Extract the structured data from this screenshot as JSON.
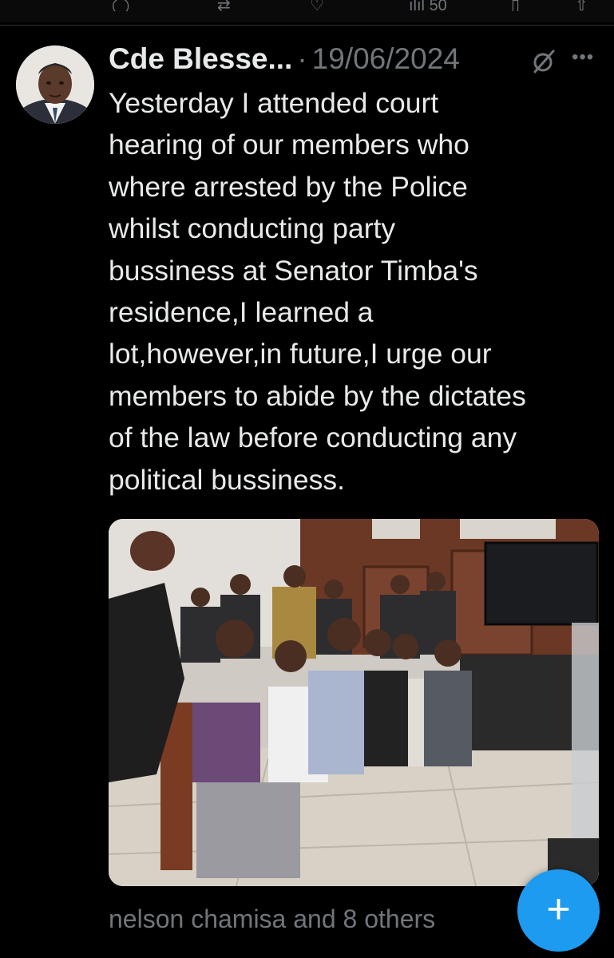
{
  "tweet": {
    "author": "Cde Blesse...",
    "separator": "·",
    "date": "19/06/2024",
    "text": "Yesterday I attended court\nhearing of our members who\nwhere arrested by the Police\nwhilst conducting party\nbussiness at Senator Timba's\nresidence,I learned a\nlot,however,in future,I urge our\nmembers to abide by the dictates\nof the law before conducting any\npolitical bussiness.",
    "likes_summary": "nelson chamisa and 8 others"
  },
  "top_actions": {
    "views_count": "50"
  },
  "icons": {
    "avatar": "author-avatar",
    "grok": "grok-icon",
    "more": "more-options-icon",
    "compose": "plus-icon"
  },
  "colors": {
    "background": "#000000",
    "text": "#e7e9ea",
    "muted": "#71767b",
    "accent": "#1d9bf0"
  }
}
